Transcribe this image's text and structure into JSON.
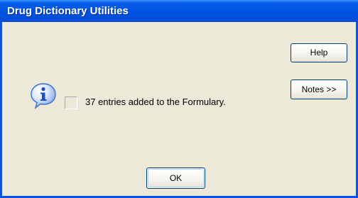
{
  "window": {
    "title": "Drug Dictionary Utilities"
  },
  "dialog": {
    "icon": "information-icon",
    "message": "37 entries added to the Formulary."
  },
  "buttons": {
    "help_label": "Help",
    "notes_label": "Notes >>",
    "ok_label": "OK"
  },
  "colors": {
    "titlebar": "#0054e3",
    "window_background": "#ece9d8",
    "button_border": "#003c74",
    "info_icon": "#3b6fd1"
  }
}
